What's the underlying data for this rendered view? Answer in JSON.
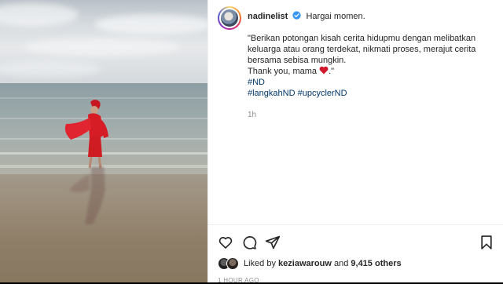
{
  "post": {
    "username": "nadinelist",
    "headline": "Hargai momen.",
    "caption_lines": [
      "\"Berikan potongan kisah cerita hidupmu dengan melibatkan",
      "keluarga atau orang terdekat, nikmati proses, merajut cerita",
      "bersama sebisa mungkin.",
      "Thank you, mama"
    ],
    "caption_end": ".\"",
    "hashtags": [
      "#ND",
      "#langkahND #upcyclerND"
    ],
    "relative_time": "1h",
    "likes": {
      "prefix": "Liked by",
      "user": "keziawarouw",
      "connector": "and",
      "count": "9,415 others"
    },
    "posted_ago": "1 HOUR AGO"
  },
  "colors": {
    "verified_blue": "#3897f0",
    "heart_red": "#d2182d",
    "link_blue": "#00376b"
  },
  "icons": [
    "verified-badge-icon",
    "heart-emoji-icon",
    "like-icon",
    "comment-icon",
    "share-icon",
    "save-icon"
  ]
}
